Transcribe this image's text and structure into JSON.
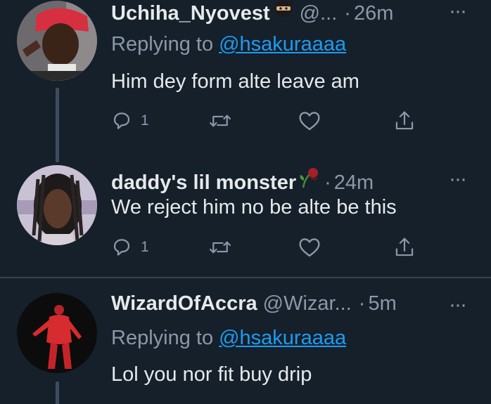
{
  "tweets": [
    {
      "display_name": "Uchiha_Nyovest",
      "name_emoji": "ninja-emoji",
      "handle": "@...",
      "dot": "·",
      "time": "26m",
      "replying_prefix": "Replying to",
      "replying_to": "@hsakuraaaa",
      "text": "Him dey form alte leave am",
      "reply_count": "1",
      "more": "···"
    },
    {
      "display_name": "daddy's lil monster",
      "name_emoji": "wilted-rose-emoji",
      "handle": "",
      "dot": "·",
      "time": "24m",
      "text": "We reject him no be alte be this",
      "reply_count": "1",
      "more": "···"
    },
    {
      "display_name": "WizardOfAccra",
      "handle": "@Wizar...",
      "dot": "·",
      "time": "5m",
      "replying_prefix": "Replying to",
      "replying_to": "@hsakuraaaa",
      "text": "Lol you nor fit buy drip",
      "more": "···"
    }
  ],
  "icons": {
    "reply": "reply-icon",
    "retweet": "retweet-icon",
    "like": "heart-icon",
    "share": "share-icon",
    "more": "more-icon"
  },
  "colors": {
    "background": "#15202b",
    "text_primary": "#e7e9ea",
    "text_secondary": "#8b98a5",
    "link": "#1d9bf0",
    "divider": "#38444d"
  }
}
